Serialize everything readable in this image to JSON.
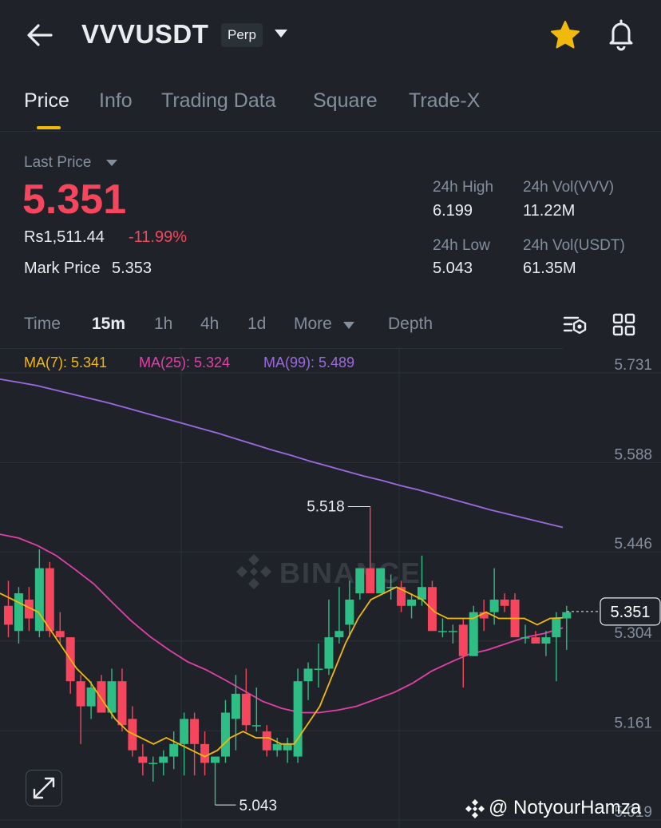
{
  "header": {
    "pair": "VVVUSDT",
    "contract_type": "Perp",
    "back_icon": "arrow-left-icon",
    "favorite_icon": "star-icon",
    "alert_icon": "bell-icon",
    "favorite_color": "#f0b90b"
  },
  "tabs": [
    "Price",
    "Info",
    "Trading Data",
    "Square",
    "Trade-X"
  ],
  "active_tab": "Price",
  "ticker": {
    "last_price_label": "Last Price",
    "last_price": "5.351",
    "fiat_price": "Rs1,511.44",
    "change_pct": "-11.99%",
    "mark_price_label": "Mark Price",
    "mark_price": "5.353",
    "high_label": "24h High",
    "high": "6.199",
    "low_label": "24h Low",
    "low": "5.043",
    "vol_base_label": "24h Vol(VVV)",
    "vol_base": "11.22M",
    "vol_quote_label": "24h Vol(USDT)",
    "vol_quote": "61.35M"
  },
  "intervals": {
    "items": [
      "Time",
      "15m",
      "1h",
      "4h",
      "1d",
      "More",
      "Depth"
    ],
    "active": "15m",
    "settings_icon": "chart-settings-icon",
    "layout_icon": "grid-layout-icon"
  },
  "indicators": {
    "ma7": "MA(7): 5.341",
    "ma25": "MA(25): 5.324",
    "ma99": "MA(99): 5.489",
    "ma7_color": "#f0b90b",
    "ma25_color": "#e040a8",
    "ma99_color": "#9c6ade"
  },
  "colors": {
    "up": "#2ebd85",
    "down": "#f6465d",
    "background": "#1f2329"
  },
  "watermark": {
    "brand": "BINANCE",
    "user": "@ NotyourHamza"
  },
  "chart_data": {
    "type": "candlestick",
    "interval": "15m",
    "y_ticks": [
      "5.731",
      "5.588",
      "5.446",
      "5.304",
      "5.161",
      "5.019"
    ],
    "ylim": [
      5.019,
      5.731
    ],
    "current_price_label": "5.351",
    "max_annotation": "5.518",
    "min_annotation": "5.043",
    "grid": true,
    "candles": [
      {
        "o": 5.36,
        "h": 5.4,
        "l": 5.31,
        "c": 5.33
      },
      {
        "o": 5.32,
        "h": 5.39,
        "l": 5.3,
        "c": 5.38
      },
      {
        "o": 5.37,
        "h": 5.39,
        "l": 5.32,
        "c": 5.34
      },
      {
        "o": 5.32,
        "h": 5.45,
        "l": 5.31,
        "c": 5.42
      },
      {
        "o": 5.42,
        "h": 5.43,
        "l": 5.31,
        "c": 5.32
      },
      {
        "o": 5.32,
        "h": 5.35,
        "l": 5.3,
        "c": 5.31
      },
      {
        "o": 5.31,
        "h": 5.31,
        "l": 5.22,
        "c": 5.24
      },
      {
        "o": 5.24,
        "h": 5.25,
        "l": 5.14,
        "c": 5.2
      },
      {
        "o": 5.2,
        "h": 5.24,
        "l": 5.18,
        "c": 5.23
      },
      {
        "o": 5.24,
        "h": 5.25,
        "l": 5.2,
        "c": 5.19
      },
      {
        "o": 5.19,
        "h": 5.26,
        "l": 5.18,
        "c": 5.24
      },
      {
        "o": 5.24,
        "h": 5.26,
        "l": 5.16,
        "c": 5.17
      },
      {
        "o": 5.18,
        "h": 5.2,
        "l": 5.12,
        "c": 5.13
      },
      {
        "o": 5.12,
        "h": 5.14,
        "l": 5.09,
        "c": 5.11
      },
      {
        "o": 5.11,
        "h": 5.12,
        "l": 5.08,
        "c": 5.11
      },
      {
        "o": 5.11,
        "h": 5.13,
        "l": 5.09,
        "c": 5.12
      },
      {
        "o": 5.12,
        "h": 5.16,
        "l": 5.1,
        "c": 5.14
      },
      {
        "o": 5.14,
        "h": 5.19,
        "l": 5.09,
        "c": 5.18
      },
      {
        "o": 5.18,
        "h": 5.19,
        "l": 5.09,
        "c": 5.14
      },
      {
        "o": 5.14,
        "h": 5.16,
        "l": 5.09,
        "c": 5.11
      },
      {
        "o": 5.11,
        "h": 5.12,
        "l": 5.043,
        "c": 5.12
      },
      {
        "o": 5.12,
        "h": 5.21,
        "l": 5.11,
        "c": 5.19
      },
      {
        "o": 5.18,
        "h": 5.25,
        "l": 5.13,
        "c": 5.22
      },
      {
        "o": 5.22,
        "h": 5.26,
        "l": 5.16,
        "c": 5.17
      },
      {
        "o": 5.17,
        "h": 5.23,
        "l": 5.16,
        "c": 5.17
      },
      {
        "o": 5.16,
        "h": 5.17,
        "l": 5.12,
        "c": 5.13
      },
      {
        "o": 5.13,
        "h": 5.15,
        "l": 5.12,
        "c": 5.14
      },
      {
        "o": 5.13,
        "h": 5.15,
        "l": 5.11,
        "c": 5.14
      },
      {
        "o": 5.12,
        "h": 5.26,
        "l": 5.11,
        "c": 5.24
      },
      {
        "o": 5.24,
        "h": 5.27,
        "l": 5.21,
        "c": 5.26
      },
      {
        "o": 5.26,
        "h": 5.3,
        "l": 5.23,
        "c": 5.26
      },
      {
        "o": 5.26,
        "h": 5.37,
        "l": 5.25,
        "c": 5.31
      },
      {
        "o": 5.31,
        "h": 5.39,
        "l": 5.3,
        "c": 5.32
      },
      {
        "o": 5.33,
        "h": 5.4,
        "l": 5.31,
        "c": 5.37
      },
      {
        "o": 5.38,
        "h": 5.42,
        "l": 5.37,
        "c": 5.42
      },
      {
        "o": 5.42,
        "h": 5.518,
        "l": 5.39,
        "c": 5.38
      },
      {
        "o": 5.38,
        "h": 5.42,
        "l": 5.38,
        "c": 5.42
      },
      {
        "o": 5.39,
        "h": 5.41,
        "l": 5.37,
        "c": 5.39
      },
      {
        "o": 5.39,
        "h": 5.4,
        "l": 5.35,
        "c": 5.36
      },
      {
        "o": 5.36,
        "h": 5.38,
        "l": 5.34,
        "c": 5.37
      },
      {
        "o": 5.37,
        "h": 5.44,
        "l": 5.36,
        "c": 5.39
      },
      {
        "o": 5.39,
        "h": 5.4,
        "l": 5.32,
        "c": 5.32
      },
      {
        "o": 5.32,
        "h": 5.34,
        "l": 5.31,
        "c": 5.32
      },
      {
        "o": 5.32,
        "h": 5.33,
        "l": 5.3,
        "c": 5.32
      },
      {
        "o": 5.33,
        "h": 5.34,
        "l": 5.23,
        "c": 5.28
      },
      {
        "o": 5.28,
        "h": 5.36,
        "l": 5.28,
        "c": 5.35
      },
      {
        "o": 5.35,
        "h": 5.37,
        "l": 5.32,
        "c": 5.34
      },
      {
        "o": 5.35,
        "h": 5.42,
        "l": 5.33,
        "c": 5.37
      },
      {
        "o": 5.37,
        "h": 5.38,
        "l": 5.35,
        "c": 5.36
      },
      {
        "o": 5.37,
        "h": 5.38,
        "l": 5.32,
        "c": 5.31
      },
      {
        "o": 5.31,
        "h": 5.33,
        "l": 5.3,
        "c": 5.31
      },
      {
        "o": 5.31,
        "h": 5.32,
        "l": 5.3,
        "c": 5.3
      },
      {
        "o": 5.3,
        "h": 5.32,
        "l": 5.28,
        "c": 5.31
      },
      {
        "o": 5.31,
        "h": 5.35,
        "l": 5.24,
        "c": 5.34
      },
      {
        "o": 5.34,
        "h": 5.36,
        "l": 5.29,
        "c": 5.35
      }
    ],
    "ma99": [
      5.721,
      5.716,
      5.711,
      5.704,
      5.697,
      5.69,
      5.683,
      5.675,
      5.667,
      5.659,
      5.651,
      5.643,
      5.635,
      5.626,
      5.617,
      5.608,
      5.6,
      5.591,
      5.583,
      5.575,
      5.567,
      5.56,
      5.552,
      5.545,
      5.537,
      5.529,
      5.521,
      5.513,
      5.506,
      5.499,
      5.492,
      5.485
    ],
    "ma25": [
      5.474,
      5.468,
      5.456,
      5.44,
      5.418,
      5.395,
      5.365,
      5.336,
      5.311,
      5.29,
      5.271,
      5.258,
      5.242,
      5.225,
      5.208,
      5.197,
      5.19,
      5.19,
      5.194,
      5.2,
      5.211,
      5.222,
      5.237,
      5.256,
      5.27,
      5.283,
      5.29,
      5.3,
      5.31,
      5.316,
      5.325
    ],
    "ma7": [
      5.38,
      5.37,
      5.36,
      5.35,
      5.32,
      5.29,
      5.26,
      5.24,
      5.21,
      5.18,
      5.16,
      5.15,
      5.14,
      5.15,
      5.14,
      5.13,
      5.12,
      5.13,
      5.15,
      5.16,
      5.15,
      5.15,
      5.14,
      5.14,
      5.17,
      5.2,
      5.25,
      5.3,
      5.34,
      5.37,
      5.38,
      5.39,
      5.38,
      5.37,
      5.35,
      5.34,
      5.34,
      5.34,
      5.35,
      5.34,
      5.34,
      5.34,
      5.33,
      5.34,
      5.341
    ]
  }
}
